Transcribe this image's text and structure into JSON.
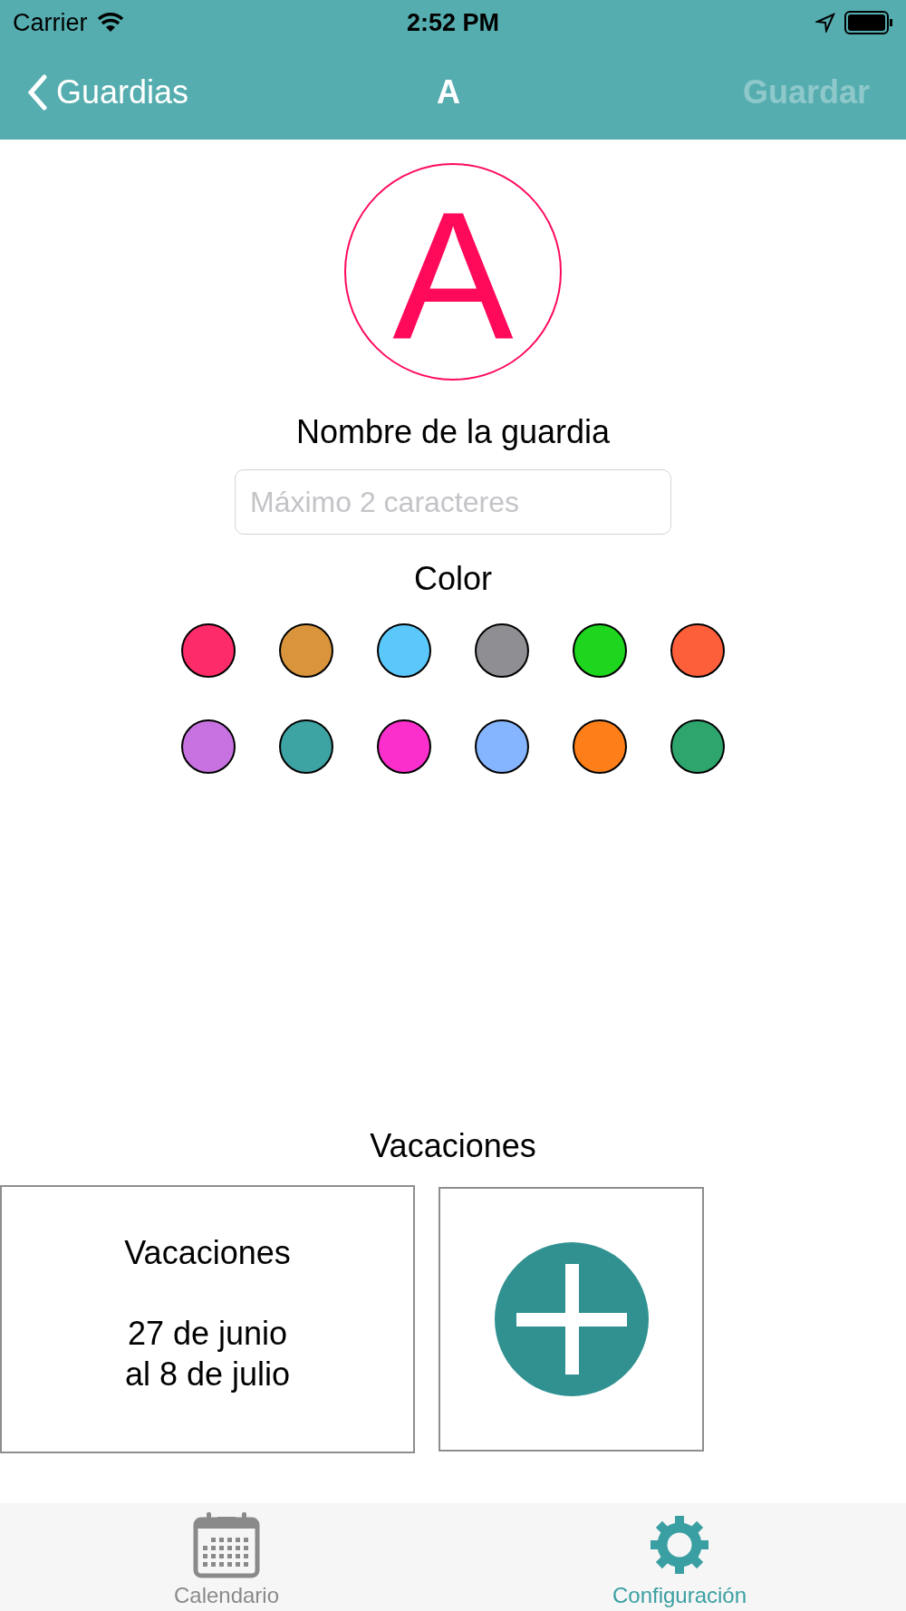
{
  "status_bar": {
    "carrier": "Carrier",
    "time": "2:52 PM"
  },
  "nav": {
    "back": "Guardias",
    "title": "A",
    "action": {
      "label": "Guardar",
      "disabled": true
    }
  },
  "avatar": {
    "letter": "A",
    "color": "#ff0a5a"
  },
  "name_label": "Nombre de la guardia",
  "name_field": {
    "placeholder": "Máximo 2 caracteres"
  },
  "color_label": "Color",
  "colors": [
    {
      "color": "#fe2b69"
    },
    {
      "color": "#d9943c"
    },
    {
      "color": "#5bc8fb"
    },
    {
      "color": "#8e8e93"
    },
    {
      "color": "#1dd61d"
    },
    {
      "color": "#fe5f3b"
    },
    {
      "color": "#c772e0"
    },
    {
      "color": "#3ea3a3"
    },
    {
      "color": "#fb2fcb"
    },
    {
      "color": "#85b5fe"
    },
    {
      "color": "#fe7f19"
    },
    {
      "color": "#2da56d"
    }
  ],
  "vacations_label": "Vacaciones",
  "vacations": [
    {
      "title": "Vacaciones",
      "dates": [
        "27 de junio",
        "al 8 de julio"
      ]
    }
  ],
  "tabs": [
    {
      "label": "Calendario",
      "kind": "calendar",
      "selected": false
    },
    {
      "label": "Configuración",
      "kind": "gear",
      "selected": true
    }
  ]
}
